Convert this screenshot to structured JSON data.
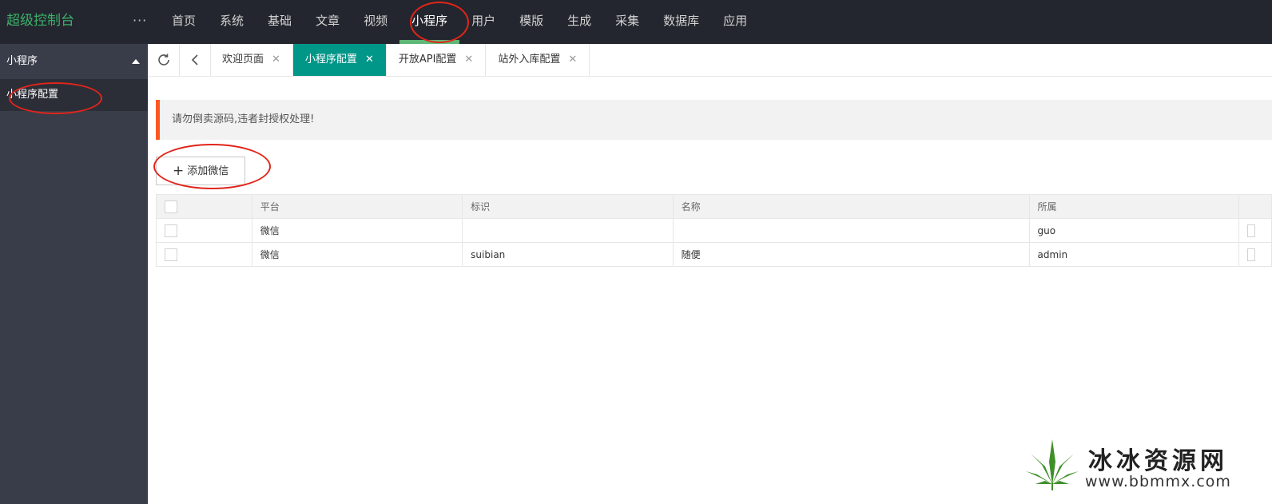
{
  "header": {
    "logo": "超级控制台",
    "more": "···",
    "nav": [
      {
        "label": "首页"
      },
      {
        "label": "系统"
      },
      {
        "label": "基础"
      },
      {
        "label": "文章"
      },
      {
        "label": "视频"
      },
      {
        "label": "小程序",
        "active": true
      },
      {
        "label": "用户"
      },
      {
        "label": "模版"
      },
      {
        "label": "生成"
      },
      {
        "label": "采集"
      },
      {
        "label": "数据库"
      },
      {
        "label": "应用"
      }
    ]
  },
  "sidebar": {
    "group": "小程序",
    "items": [
      {
        "label": "小程序配置",
        "active": true
      }
    ]
  },
  "tabs": [
    {
      "label": "欢迎页面"
    },
    {
      "label": "小程序配置",
      "active": true
    },
    {
      "label": "开放API配置"
    },
    {
      "label": "站外入库配置"
    }
  ],
  "tab_close": "✕",
  "notice": "请勿倒卖源码,违者封授权处理!",
  "add_button": {
    "icon": "+",
    "label": "添加微信"
  },
  "table": {
    "columns": [
      "平台",
      "标识",
      "名称",
      "所属"
    ],
    "rows": [
      {
        "platform": "微信",
        "ident": "",
        "name": "",
        "owner": "guo"
      },
      {
        "platform": "微信",
        "ident": "suibian",
        "name": "随便",
        "owner": "admin"
      }
    ]
  },
  "colors": {
    "topbar": "#23262e",
    "sidebar": "#393d49",
    "logo": "#3db06b",
    "active_tab": "#009688",
    "notice_accent": "#ff5722",
    "annotation": "#e0251b"
  },
  "watermark": {
    "cn": "冰冰资源网",
    "url": "www.bbmmx.com"
  }
}
